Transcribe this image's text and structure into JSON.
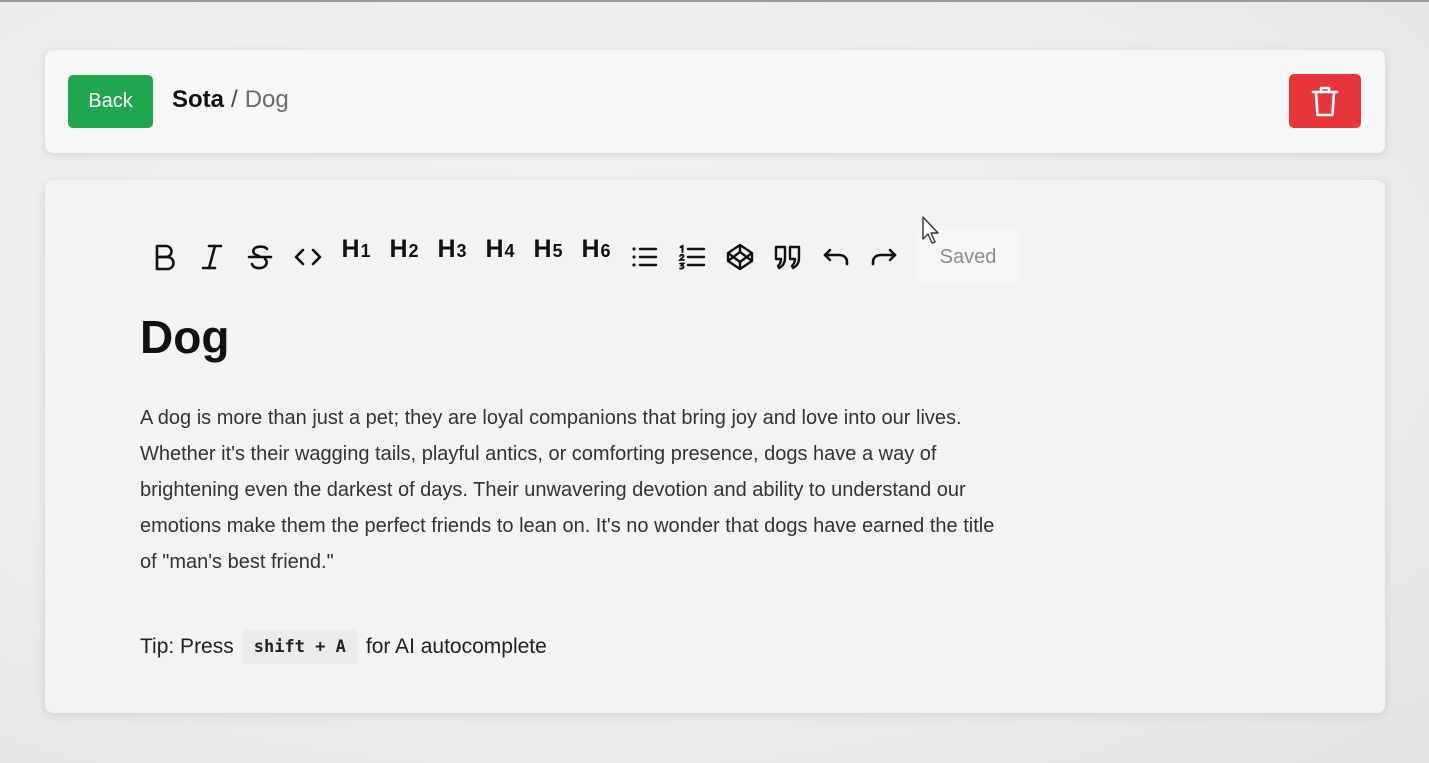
{
  "header": {
    "back_label": "Back",
    "breadcrumb": {
      "parent": "Sota",
      "separator": "/",
      "current": "Dog"
    },
    "delete_icon": "trash-icon"
  },
  "toolbar": {
    "items": [
      {
        "name": "bold",
        "icon": "bold-icon"
      },
      {
        "name": "italic",
        "icon": "italic-icon"
      },
      {
        "name": "strikethrough",
        "icon": "strikethrough-icon"
      },
      {
        "name": "code",
        "icon": "code-icon"
      },
      {
        "name": "heading-1",
        "label": "H",
        "sub": "1"
      },
      {
        "name": "heading-2",
        "label": "H",
        "sub": "2"
      },
      {
        "name": "heading-3",
        "label": "H",
        "sub": "3"
      },
      {
        "name": "heading-4",
        "label": "H",
        "sub": "4"
      },
      {
        "name": "heading-5",
        "label": "H",
        "sub": "5"
      },
      {
        "name": "heading-6",
        "label": "H",
        "sub": "6"
      },
      {
        "name": "bullet-list",
        "icon": "bullet-list-icon"
      },
      {
        "name": "ordered-list",
        "icon": "ordered-list-icon"
      },
      {
        "name": "code-block",
        "icon": "codepen-icon"
      },
      {
        "name": "blockquote",
        "icon": "quote-icon"
      },
      {
        "name": "undo",
        "icon": "undo-icon"
      },
      {
        "name": "redo",
        "icon": "redo-icon"
      }
    ],
    "status": "Saved"
  },
  "document": {
    "title": "Dog",
    "body": "A dog is more than just a pet; they are loyal companions that bring joy and love into our lives. Whether it's their wagging tails, playful antics, or comforting presence, dogs have a way of brightening even the darkest of days. Their unwavering devotion and ability to understand our emotions make them the perfect friends to lean on. It's no wonder that dogs have earned the title of \"man's best friend.\""
  },
  "tip": {
    "prefix": "Tip: Press",
    "shortcut": "shift + A",
    "suffix": "for AI autocomplete"
  },
  "colors": {
    "back_button": "#1fa64e",
    "delete_button": "#e6363a",
    "saved_text": "#8c8c8c"
  }
}
